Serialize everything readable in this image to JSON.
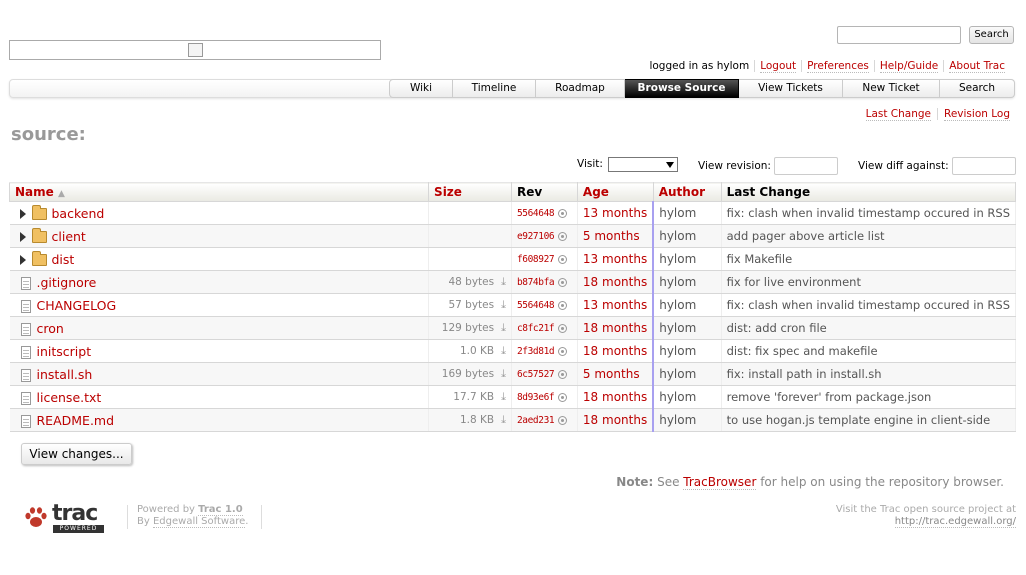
{
  "search": {
    "button_label": "Search",
    "placeholder": ""
  },
  "metanav": [
    {
      "label": "logged in as hylom",
      "link": false
    },
    {
      "label": "Logout",
      "link": true
    },
    {
      "label": "Preferences",
      "link": true
    },
    {
      "label": "Help/Guide",
      "link": true
    },
    {
      "label": "About Trac",
      "link": true
    }
  ],
  "mainnav": [
    {
      "label": "Wiki",
      "active": false
    },
    {
      "label": "Timeline",
      "active": false
    },
    {
      "label": "Roadmap",
      "active": false
    },
    {
      "label": "Browse Source",
      "active": true
    },
    {
      "label": "View Tickets",
      "active": false
    },
    {
      "label": "New Ticket",
      "active": false
    },
    {
      "label": "Search",
      "active": false
    }
  ],
  "ctxtnav": {
    "last_change": "Last Change",
    "revision_log": "Revision Log"
  },
  "page_title": "source:",
  "controls": {
    "visit_label": "Visit:",
    "visit_value": "",
    "view_revision_label": "View revision:",
    "view_diff_label": "View diff against:"
  },
  "table": {
    "headers": {
      "name": "Name",
      "size": "Size",
      "rev": "Rev",
      "age": "Age",
      "author": "Author",
      "change": "Last Change"
    },
    "sort_indicator": "▲",
    "rows": [
      {
        "type": "dir",
        "name": "backend",
        "size": "",
        "rev": "5564648",
        "age": "13 months",
        "author": "hylom",
        "change": "fix: clash when invalid timestamp occured in RSS"
      },
      {
        "type": "dir",
        "name": "client",
        "size": "",
        "rev": "e927106",
        "age": "5 months",
        "author": "hylom",
        "change": "add pager above article list"
      },
      {
        "type": "dir",
        "name": "dist",
        "size": "",
        "rev": "f608927",
        "age": "13 months",
        "author": "hylom",
        "change": "fix Makefile"
      },
      {
        "type": "file",
        "name": ".gitignore",
        "size": "48 bytes",
        "rev": "b874bfa",
        "age": "18 months",
        "author": "hylom",
        "change": "fix for live environment"
      },
      {
        "type": "file",
        "name": "CHANGELOG",
        "size": "57 bytes",
        "rev": "5564648",
        "age": "13 months",
        "author": "hylom",
        "change": "fix: clash when invalid timestamp occured in RSS"
      },
      {
        "type": "file",
        "name": "cron",
        "size": "129 bytes",
        "rev": "c8fc21f",
        "age": "18 months",
        "author": "hylom",
        "change": "dist: add cron file"
      },
      {
        "type": "file",
        "name": "initscript",
        "size": "1.0 KB",
        "rev": "2f3d81d",
        "age": "18 months",
        "author": "hylom",
        "change": "dist: fix spec and makefile"
      },
      {
        "type": "file",
        "name": "install.sh",
        "size": "169 bytes",
        "rev": "6c57527",
        "age": "5 months",
        "author": "hylom",
        "change": "fix: install path in install.sh"
      },
      {
        "type": "file",
        "name": "license.txt",
        "size": "17.7 KB",
        "rev": "8d93e6f",
        "age": "18 months",
        "author": "hylom",
        "change": "remove 'forever' from package.json"
      },
      {
        "type": "file",
        "name": "README.md",
        "size": "1.8 KB",
        "rev": "2aed231",
        "age": "18 months",
        "author": "hylom",
        "change": "to use hogan.js template engine in client-side"
      }
    ]
  },
  "view_changes_label": "View changes...",
  "help_note": {
    "note_label": "Note:",
    "see": "See",
    "link": "TracBrowser",
    "rest": "for help on using the repository browser."
  },
  "footer": {
    "logo_word": "trac",
    "logo_strip": "POWERED",
    "powered_by": "Powered by",
    "trac_version": "Trac 1.0",
    "by": "By",
    "edgewall": "Edgewall Software",
    "visit_text": "Visit the Trac open source project at",
    "visit_url": "http://trac.edgewall.org/"
  }
}
